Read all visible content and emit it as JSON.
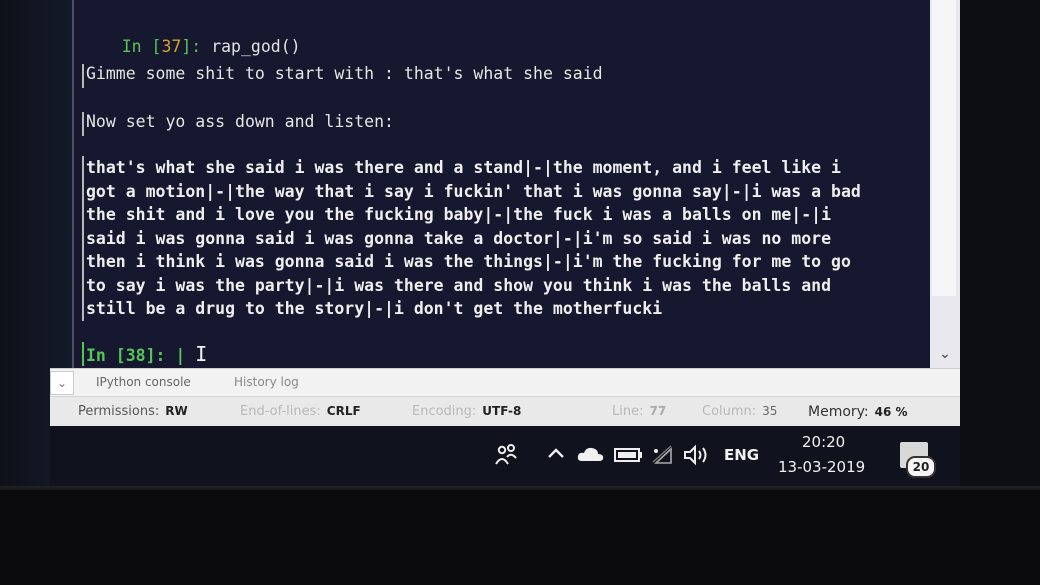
{
  "console": {
    "cell37_prompt_in": "In [",
    "cell37_prompt_num": "37",
    "cell37_prompt_close": "]: ",
    "cell37_code": "rap_god()",
    "line_gimme": "Gimme some shit to start with : that's what she said",
    "line_now": "Now set yo ass down and listen:",
    "output_lines": [
      "that's what she said i was there and a stand|-|the moment, and i feel like i",
      "got a motion|-|the way that i say i fuckin' that i was gonna say|-|i was a bad",
      "the shit and i love you the fucking baby|-|the fuck i was a balls on me|-|i",
      "said i was gonna said i was gonna take a doctor|-|i'm so said i was no more",
      "then i think i was gonna said i was the things|-|i'm the fucking for me to go",
      "to say i was the party|-|i was there and show you think i was the balls and",
      "still be a drug to the story|-|i don't get the motherfucki"
    ],
    "cell38_prompt": "In [38]: |",
    "cursor": "I"
  },
  "tabs": {
    "console_tab": "IPython console",
    "history_tab": "History log",
    "toggle": "⌄"
  },
  "status": {
    "permissions_label": "Permissions:",
    "permissions_value": "RW",
    "eol_label": "End-of-lines:",
    "eol_value": "CRLF",
    "encoding_label": "Encoding:",
    "encoding_value": "UTF-8",
    "line_label": "Line:",
    "line_value": "77",
    "column_label": "Column:",
    "column_value": "35",
    "memory_label": "Memory:",
    "memory_value": "46 %"
  },
  "taskbar": {
    "language": "ENG",
    "time": "20:20",
    "date": "13-03-2019",
    "notification_count": "20"
  },
  "colors": {
    "console_bg": "#15182e",
    "prompt_green": "#56c456",
    "prompt_orange": "#d6a32a"
  }
}
